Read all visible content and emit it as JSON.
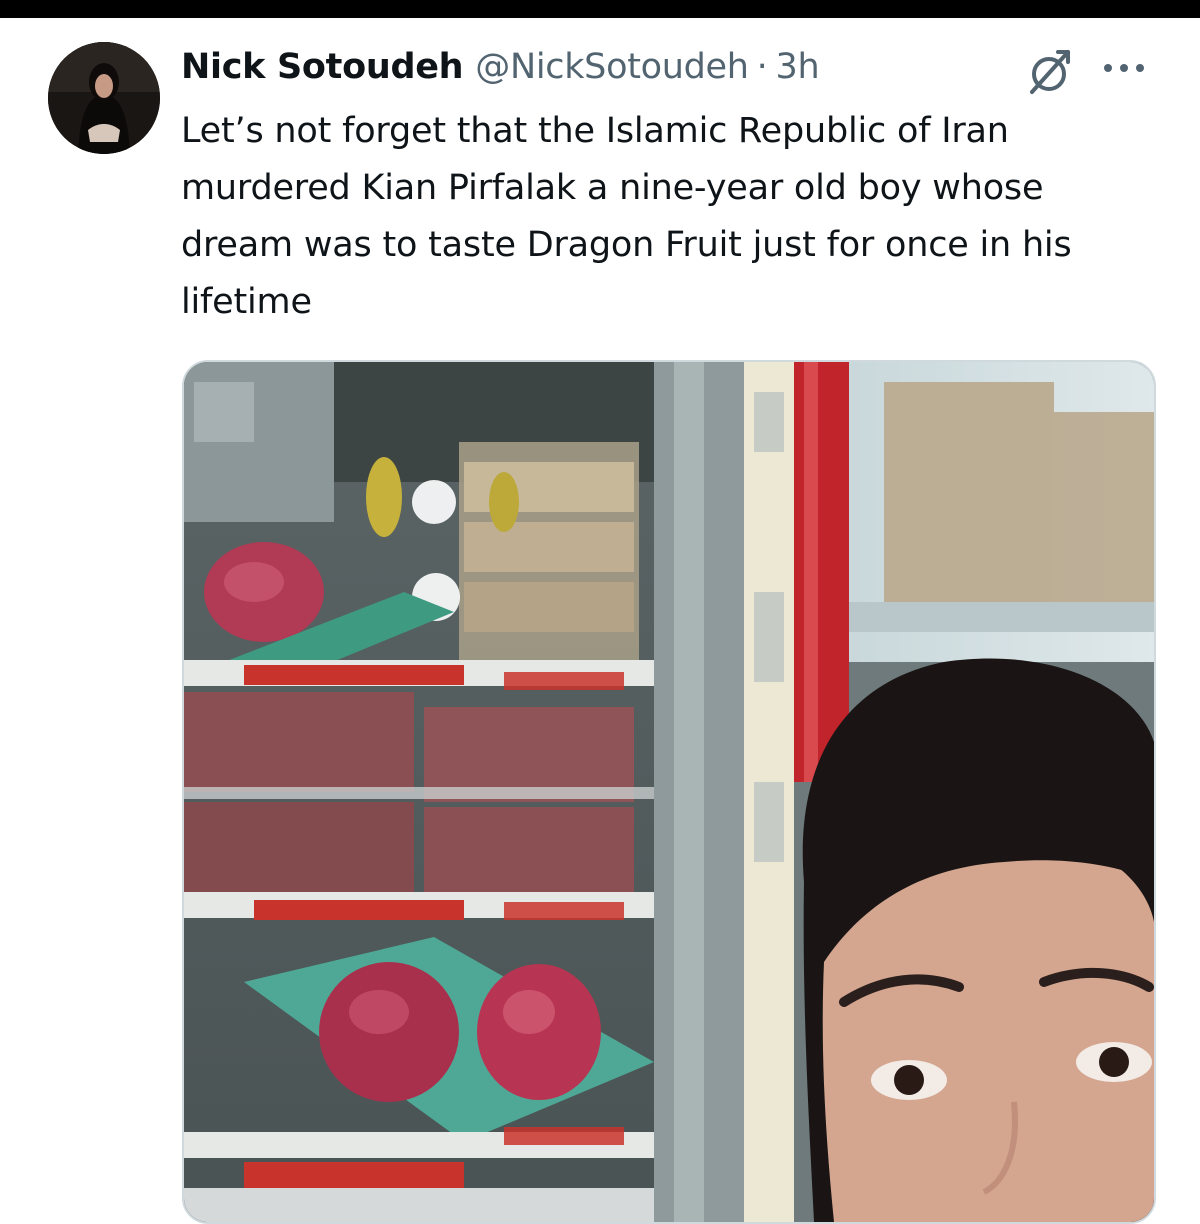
{
  "tweet": {
    "author_name": "Nick Sotoudeh",
    "author_handle": "@NickSotoudeh",
    "separator": "·",
    "timestamp": "3h",
    "text": "Let’s not forget that the Islamic Republic of Iran\nmurdered Kian Pirfalak a nine-year old boy whose\ndream was to taste Dragon Fruit just for once in his\nlifetime"
  },
  "icons": {
    "grok": "grok-icon",
    "more": "more-icon"
  },
  "colors": {
    "text_primary": "#0f1419",
    "text_secondary": "#536471",
    "media_border": "#cfd9de"
  }
}
